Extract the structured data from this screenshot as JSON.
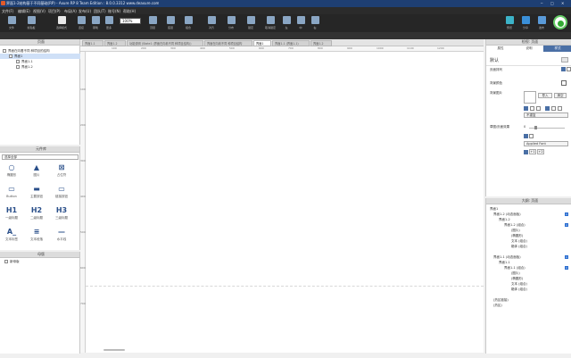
{
  "window": {
    "title": "界面1-2结构基于不同基础(RP) - Axure RP 8 Team Edition : 8.0.0.3312 www.deaxure.com"
  },
  "menu": [
    "文件(F)",
    "编辑(E)",
    "视图(V)",
    "项目(P)",
    "布局(A)",
    "发布(U)",
    "团队(T)",
    "账号(N)",
    "帮助(H)"
  ],
  "toolbar": {
    "buttons": [
      "文件",
      "剪贴板",
      "选择模式",
      "连接",
      "钢笔",
      "更多",
      "缩放",
      "顶层",
      "底层",
      "组合",
      "取消组合",
      "对齐",
      "分布",
      "锁定",
      "取消锁定",
      "左",
      "中",
      "右"
    ],
    "zoom": "100%",
    "right_buttons": [
      "预览",
      "分享",
      "发布"
    ]
  },
  "pages_panel": {
    "title": "页面",
    "items": [
      "界面在向着不同 种项目的结构",
      "界面1",
      "界面1-1",
      "界面1-2"
    ]
  },
  "library_panel": {
    "title": "元件库",
    "selector": "选择全部",
    "widgets": [
      {
        "label": "椭圆形",
        "glyph": "○"
      },
      {
        "label": "图片",
        "glyph": "▲"
      },
      {
        "label": "占位符",
        "glyph": "⊠"
      },
      {
        "label": "Button",
        "glyph": "▭"
      },
      {
        "label": "主要按钮",
        "glyph": "▬"
      },
      {
        "label": "链接按钮",
        "glyph": "▭"
      },
      {
        "label": "一级标题",
        "glyph": "H1"
      },
      {
        "label": "二级标题",
        "glyph": "H2"
      },
      {
        "label": "三级标题",
        "glyph": "H3"
      },
      {
        "label": "文本标签",
        "glyph": "A_"
      },
      {
        "label": "文本段落",
        "glyph": "≡"
      },
      {
        "label": "水平线",
        "glyph": "—"
      }
    ]
  },
  "masters_panel": {
    "title": "母版",
    "item": "新母版"
  },
  "doc_tabs": [
    "界面1-1",
    "界面1-2",
    "功能说明 (State1 (界面在向着不同 种项目结构))",
    "界面在向着不同 种项目结构",
    "界面1",
    "界面1-1 (界面1-1)",
    "界面1-2"
  ],
  "rulers": {
    "h": [
      "100",
      "200",
      "300",
      "400",
      "500",
      "600",
      "700",
      "800",
      "900",
      "1000",
      "1100",
      "1200"
    ],
    "v": [
      "100",
      "200",
      "300",
      "400",
      "500",
      "600",
      "700"
    ]
  },
  "inspector": {
    "title": "检视: 页面",
    "tabs": [
      "属性",
      "说明",
      "样式"
    ],
    "default_label": "默认",
    "page_align": "页面排列",
    "bg_color": "背景颜色",
    "bg_image": "背景图片",
    "import": "导入",
    "clear": "清空",
    "repeat": "不重复",
    "sketch_effect": "草图/页面效果",
    "sketch_value": "0",
    "font": "Applied Font",
    "line_width": [
      "+1",
      "+2"
    ]
  },
  "outline": {
    "title": "大纲: 页面",
    "rows": [
      "界面1",
      "界面1-2 (动态面板)",
      "界面1-2",
      "界面1-2 (组合)",
      "(图片)",
      "(椭圆形)",
      "文本 (组合)",
      "箱体 (组合)",
      "界面1-1 (动态面板)",
      "界面1-1",
      "界面1-1 (组合)",
      "(图片)",
      "(椭圆形)",
      "文本 (组合)",
      "箱体 (组合)",
      "(热区链接)",
      "(热区)"
    ]
  },
  "colors": {
    "accent": "#4a6fa5",
    "titlebar": "#1e3f73",
    "toolbar": "#262626"
  }
}
